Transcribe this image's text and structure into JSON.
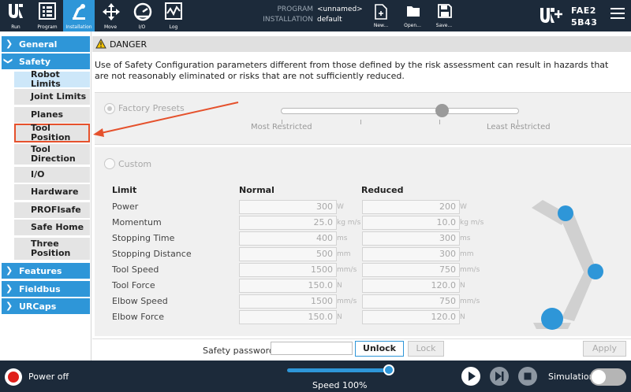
{
  "topbar": {
    "nav": [
      {
        "label": "Run",
        "icon": "ur-logo-icon"
      },
      {
        "label": "Program",
        "icon": "program-icon"
      },
      {
        "label": "Installation",
        "icon": "installation-icon"
      },
      {
        "label": "Move",
        "icon": "move-arrows-icon"
      },
      {
        "label": "I/O",
        "icon": "io-gauge-icon"
      },
      {
        "label": "Log",
        "icon": "log-chart-icon"
      }
    ],
    "program_key": "PROGRAM",
    "program_value": "<unnamed>",
    "installation_key": "INSTALLATION",
    "installation_value": "default",
    "file_buttons": [
      {
        "label": "New...",
        "icon": "new-file-icon"
      },
      {
        "label": "Open...",
        "icon": "open-folder-icon"
      },
      {
        "label": "Save...",
        "icon": "save-disk-icon"
      }
    ],
    "robot_id_line1": "FAE2",
    "robot_id_line2": "5B43"
  },
  "sidebar": {
    "sections": [
      {
        "label": "General",
        "state": "collapsed"
      },
      {
        "label": "Safety",
        "state": "expanded"
      },
      {
        "label": "Features",
        "state": "collapsed"
      },
      {
        "label": "Fieldbus",
        "state": "collapsed"
      },
      {
        "label": "URCaps",
        "state": "collapsed"
      }
    ],
    "safety_items": [
      "Robot Limits",
      "Joint Limits",
      "Planes",
      "Tool Position",
      "Tool Direction",
      "I/O",
      "Hardware",
      "PROFIsafe",
      "Safe Home",
      "Three Position"
    ],
    "selected_item": "Robot Limits",
    "highlighted_item": "Tool Position"
  },
  "main": {
    "danger_title": "DANGER",
    "danger_text": "Use of Safety Configuration parameters different from those defined by the risk assessment can result in hazards that are not reasonably eliminated or risks that are not sufficiently reduced.",
    "factory_presets_label": "Factory Presets",
    "most_restricted": "Most Restricted",
    "least_restricted": "Least Restricted",
    "custom_label": "Custom",
    "table": {
      "headers": [
        "Limit",
        "Normal",
        "Reduced"
      ],
      "rows": [
        {
          "limit": "Power",
          "normal": "300",
          "reduced": "200",
          "unit": "W"
        },
        {
          "limit": "Momentum",
          "normal": "25.0",
          "reduced": "10.0",
          "unit": "kg m/s"
        },
        {
          "limit": "Stopping Time",
          "normal": "400",
          "reduced": "300",
          "unit": "ms"
        },
        {
          "limit": "Stopping Distance",
          "normal": "500",
          "reduced": "300",
          "unit": "mm"
        },
        {
          "limit": "Tool Speed",
          "normal": "1500",
          "reduced": "750",
          "unit": "mm/s"
        },
        {
          "limit": "Tool Force",
          "normal": "150.0",
          "reduced": "120.0",
          "unit": "N"
        },
        {
          "limit": "Elbow Speed",
          "normal": "1500",
          "reduced": "750",
          "unit": "mm/s"
        },
        {
          "limit": "Elbow Force",
          "normal": "150.0",
          "reduced": "120.0",
          "unit": "N"
        }
      ]
    },
    "password_label": "Safety password",
    "password_value": "",
    "unlock_label": "Unlock",
    "lock_label": "Lock",
    "apply_label": "Apply"
  },
  "bottombar": {
    "power_label": "Power off",
    "speed_label": "Speed 100%",
    "speed_percent": 100,
    "simulation_label": "Simulation"
  },
  "colors": {
    "accent": "#2e96d8",
    "topbar": "#1c2a3a",
    "highlight": "#e5512c",
    "power_off": "#e0201b"
  }
}
